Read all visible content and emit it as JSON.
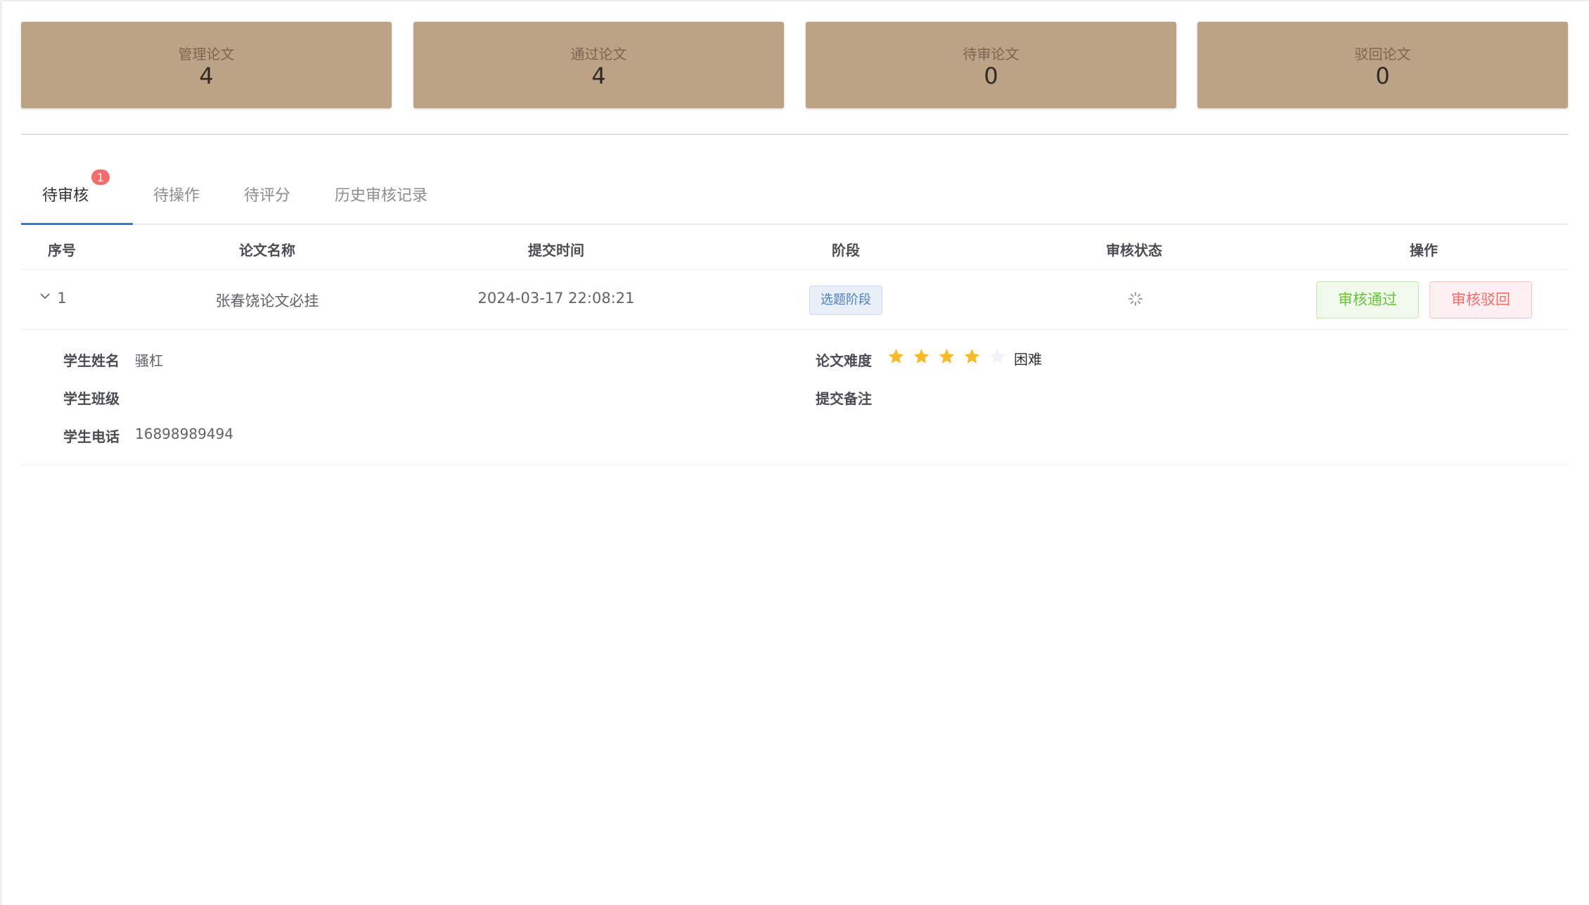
{
  "stats": [
    {
      "label": "管理论文",
      "value": "4"
    },
    {
      "label": "通过论文",
      "value": "4"
    },
    {
      "label": "待审论文",
      "value": "0"
    },
    {
      "label": "驳回论文",
      "value": "0"
    }
  ],
  "tabs": [
    {
      "label": "待审核",
      "badge": "1",
      "active": true
    },
    {
      "label": "待操作"
    },
    {
      "label": "待评分"
    },
    {
      "label": "历史审核记录"
    }
  ],
  "table": {
    "columns": [
      "序号",
      "论文名称",
      "提交时间",
      "阶段",
      "审核状态",
      "操作"
    ],
    "rows": [
      {
        "index": "1",
        "title": "张春饶论文必挂",
        "submit_time": "2024-03-17 22:08:21",
        "stage": "选题阶段",
        "status_icon": "loading-icon",
        "actions": {
          "approve": "审核通过",
          "reject": "审核驳回"
        }
      }
    ]
  },
  "detail": {
    "student_name_label": "学生姓名",
    "student_name": "骚杠",
    "student_class_label": "学生班级",
    "student_class": "",
    "student_phone_label": "学生电话",
    "student_phone": "16898989494",
    "difficulty_label": "论文难度",
    "difficulty_rating": 4,
    "difficulty_max": 5,
    "difficulty_text": "困难",
    "remark_label": "提交备注",
    "remark": ""
  },
  "colors": {
    "card_bg": "#bda385",
    "star_on": "#f7ba2a",
    "star_off": "#eff2f7",
    "accent": "#3b78c6"
  }
}
